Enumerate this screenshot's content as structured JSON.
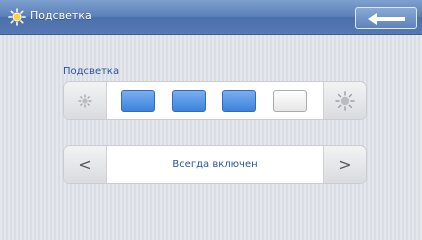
{
  "header": {
    "title": "Подсветка",
    "title_icon": "sun-icon",
    "back_icon": "back-arrow-icon"
  },
  "brightness": {
    "label": "Подсветка",
    "decrease_icon": "sun-small-icon",
    "increase_icon": "sun-large-icon",
    "levels_total": 4,
    "levels_on": 3
  },
  "mode": {
    "prev": "<",
    "value": "Всегда включен",
    "next": ">"
  },
  "colors": {
    "accent": "#2b52a0",
    "level_on": "#4a8ee0",
    "titlebar": "#5b7fb8"
  }
}
